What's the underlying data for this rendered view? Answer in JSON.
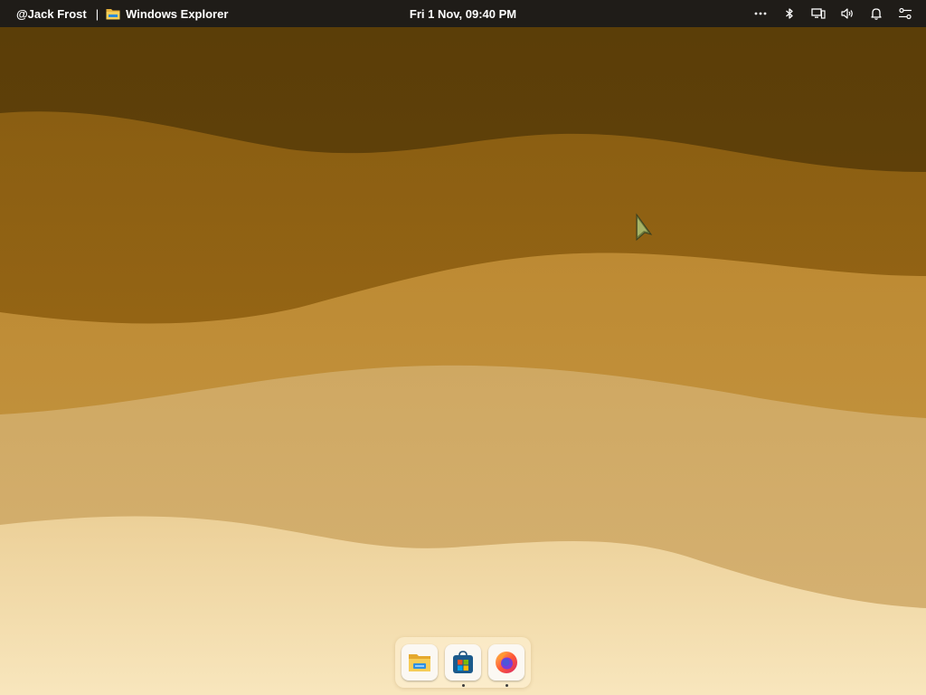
{
  "topbar": {
    "user": "@Jack Frost",
    "separator": "|",
    "active_app_icon": "folder-icon",
    "active_app": "Windows Explorer",
    "clock": "Fri 1 Nov, 09:40 PM",
    "tray": [
      {
        "name": "more-options-icon"
      },
      {
        "name": "bluetooth-icon"
      },
      {
        "name": "display-icon"
      },
      {
        "name": "volume-icon"
      },
      {
        "name": "notifications-bell-icon"
      },
      {
        "name": "settings-toggles-icon"
      }
    ]
  },
  "dock": {
    "items": [
      {
        "name": "file-explorer",
        "icon": "folder-icon",
        "running": false
      },
      {
        "name": "microsoft-store",
        "icon": "store-icon",
        "running": true
      },
      {
        "name": "firefox",
        "icon": "firefox-icon",
        "running": true
      }
    ]
  },
  "colors": {
    "topbar_bg": "#1f1c18",
    "wallpaper_top": "#5a3d08",
    "wallpaper_bottom": "#f7e4b8"
  }
}
